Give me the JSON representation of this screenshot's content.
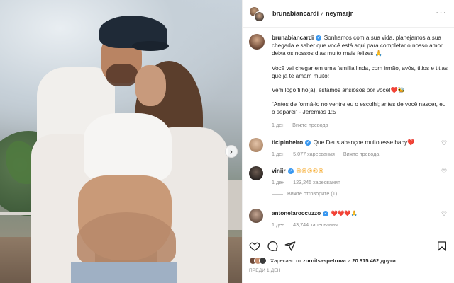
{
  "header": {
    "user1": "brunabiancardi",
    "connector": "и",
    "user2": "neymarjr",
    "more_icon": "more-horizontal-icon"
  },
  "caption": {
    "username": "brunabiancardi",
    "para1": "Sonhamos com a sua vida, planejamos a sua chegada e saber que você está aqui para completar o nosso amor, deixa os nossos dias muito mais felizes 🙏",
    "para2": "Você vai chegar em uma família linda, com irmão, avós, titios e titias que já te amam muito!",
    "para3": "Vem logo filho(a), estamos ansiosos por você!❤️🐝",
    "para4": "“Antes de formá-lo no ventre eu o escolhi; antes de você nascer, eu o separei” - Jeremias 1:5",
    "time": "1 ден",
    "action": "Вижте превода"
  },
  "comments": [
    {
      "username": "ticipinheiro",
      "verified": true,
      "text": "Que Deus abençoe muito esse baby❤️",
      "time": "1 ден",
      "likes": "5,077 харесвания",
      "action": "Вижте превода",
      "avatar_color": "#c9a88c"
    },
    {
      "username": "vinijr",
      "verified": true,
      "text": "😍😍😍😍😍",
      "time": "1 ден",
      "likes": "123,245 харесвания",
      "replies": "Вижте отговорите (1)",
      "avatar_color": "#3b3330"
    },
    {
      "username": "antonelaroccuzzo",
      "verified": true,
      "text": "❤️❤️❤️🙏",
      "time": "1 ден",
      "likes": "43,744 харесвания",
      "avatar_color": "#8d7565"
    }
  ],
  "actions": {
    "like_icon": "heart-icon",
    "comment_icon": "comment-icon",
    "share_icon": "send-icon",
    "save_icon": "bookmark-icon"
  },
  "likes": {
    "prefix": "Харесано от",
    "user": "zornitsaspetrova",
    "middle": "и",
    "count": "20 815 462",
    "suffix": "други"
  },
  "date": "ПРЕДИ 1 ДЕН"
}
